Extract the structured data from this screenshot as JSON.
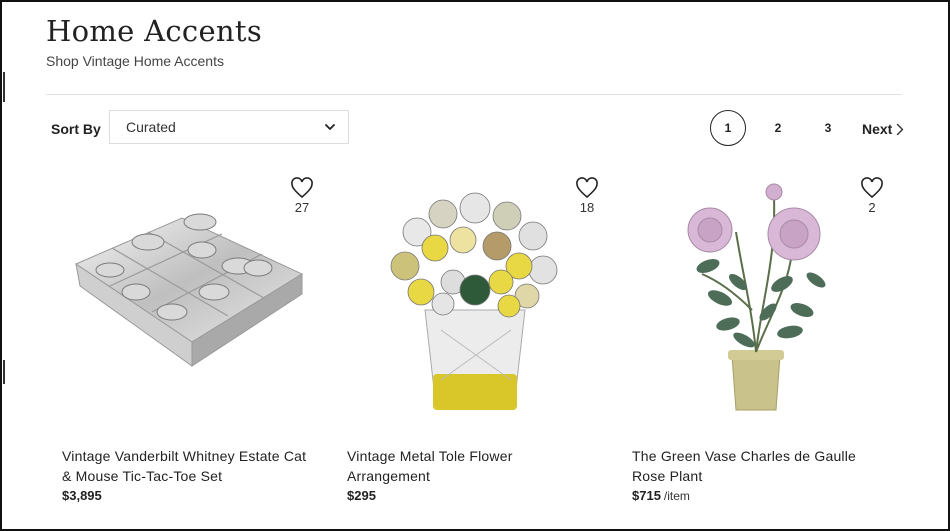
{
  "header": {
    "title": "Home Accents",
    "subtitle": "Shop Vintage Home Accents"
  },
  "toolbar": {
    "sort_label": "Sort By",
    "sort_value": "Curated"
  },
  "pagination": {
    "pages": [
      "1",
      "2",
      "3"
    ],
    "current": "1",
    "next_label": "Next"
  },
  "products": [
    {
      "name": "Vintage Vanderbilt Whitney Estate Cat & Mouse Tic-Tac-Toe Set",
      "price": "$3,895",
      "unit": "",
      "favorites": "27",
      "image_icon": "tic-tac-toe-set-image"
    },
    {
      "name": "Vintage Metal Tole Flower Arrangement",
      "price": "$295",
      "unit": "",
      "favorites": "18",
      "image_icon": "flower-arrangement-image"
    },
    {
      "name": "The Green Vase Charles de Gaulle Rose Plant",
      "price": "$715",
      "unit": "/item",
      "favorites": "2",
      "image_icon": "rose-plant-image"
    }
  ],
  "colors": {
    "text": "#222222",
    "divider": "#e3e3e3",
    "border": "#111111"
  }
}
